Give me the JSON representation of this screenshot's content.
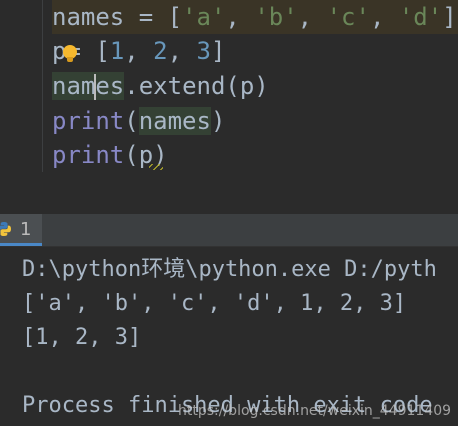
{
  "editor": {
    "line1": {
      "names": "names",
      "assign": " = [",
      "a": "'a'",
      "sep1": ", ",
      "b": "'b'",
      "sep2": ", ",
      "c": "'c'",
      "sep3": ", ",
      "d": "'d'",
      "close": "]"
    },
    "line2": {
      "p": "p",
      "assign": "= [",
      "n1": "1",
      "sep1": ", ",
      "n2": "2",
      "sep2": ", ",
      "n3": "3",
      "close": "]"
    },
    "line3": {
      "names_a": "nam",
      "names_b": "es",
      "rest": ".extend(p)"
    },
    "line4": {
      "print": "print",
      "open": "(",
      "arg": "names",
      "close": ")"
    },
    "line5": {
      "print": "print",
      "open": "(",
      "arg": "p",
      "close": ")"
    }
  },
  "run_panel": {
    "tab_label": "1",
    "tab_icon": "python-icon",
    "accent": "#4a88c7"
  },
  "console": {
    "lines": [
      "D:\\python环境\\python.exe D:/pyth",
      "['a', 'b', 'c', 'd', 1, 2, 3]",
      "[1, 2, 3]",
      "Process finished with exit code"
    ],
    "watermark": "https://blog.csdn.net/weixin_44911409"
  },
  "colors": {
    "background": "#2b2b2b",
    "text": "#a9b7c6",
    "string": "#6a8759",
    "number": "#6897bb",
    "builtin": "#8888c6"
  }
}
